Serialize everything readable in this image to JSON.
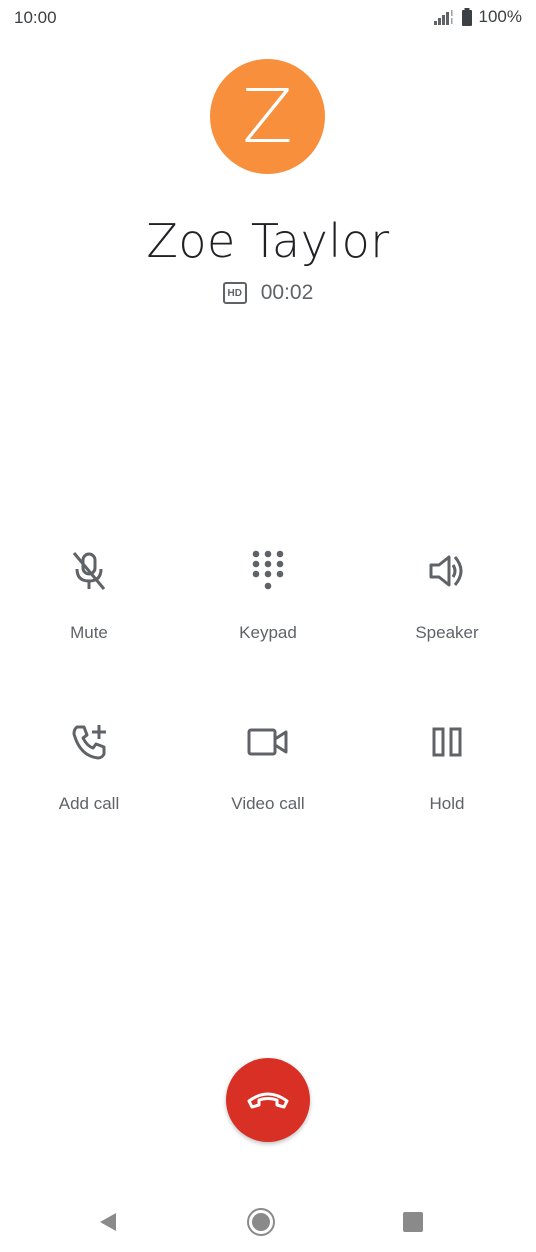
{
  "status_bar": {
    "time": "10:00",
    "battery": "100%",
    "icons": [
      "signal-icon",
      "battery-icon"
    ]
  },
  "caller": {
    "initial": "Z",
    "avatar_color": "#f78f3d",
    "name": "Zoe Taylor",
    "hd_badge": "HD",
    "duration": "00:02"
  },
  "controls": {
    "mute": "Mute",
    "keypad": "Keypad",
    "speaker": "Speaker",
    "add_call": "Add call",
    "video_call": "Video call",
    "hold": "Hold"
  },
  "end_call": {
    "icon": "end-call-icon",
    "color": "#d93025"
  },
  "nav": {
    "icons": [
      "back-icon",
      "home-icon",
      "recents-icon"
    ]
  }
}
